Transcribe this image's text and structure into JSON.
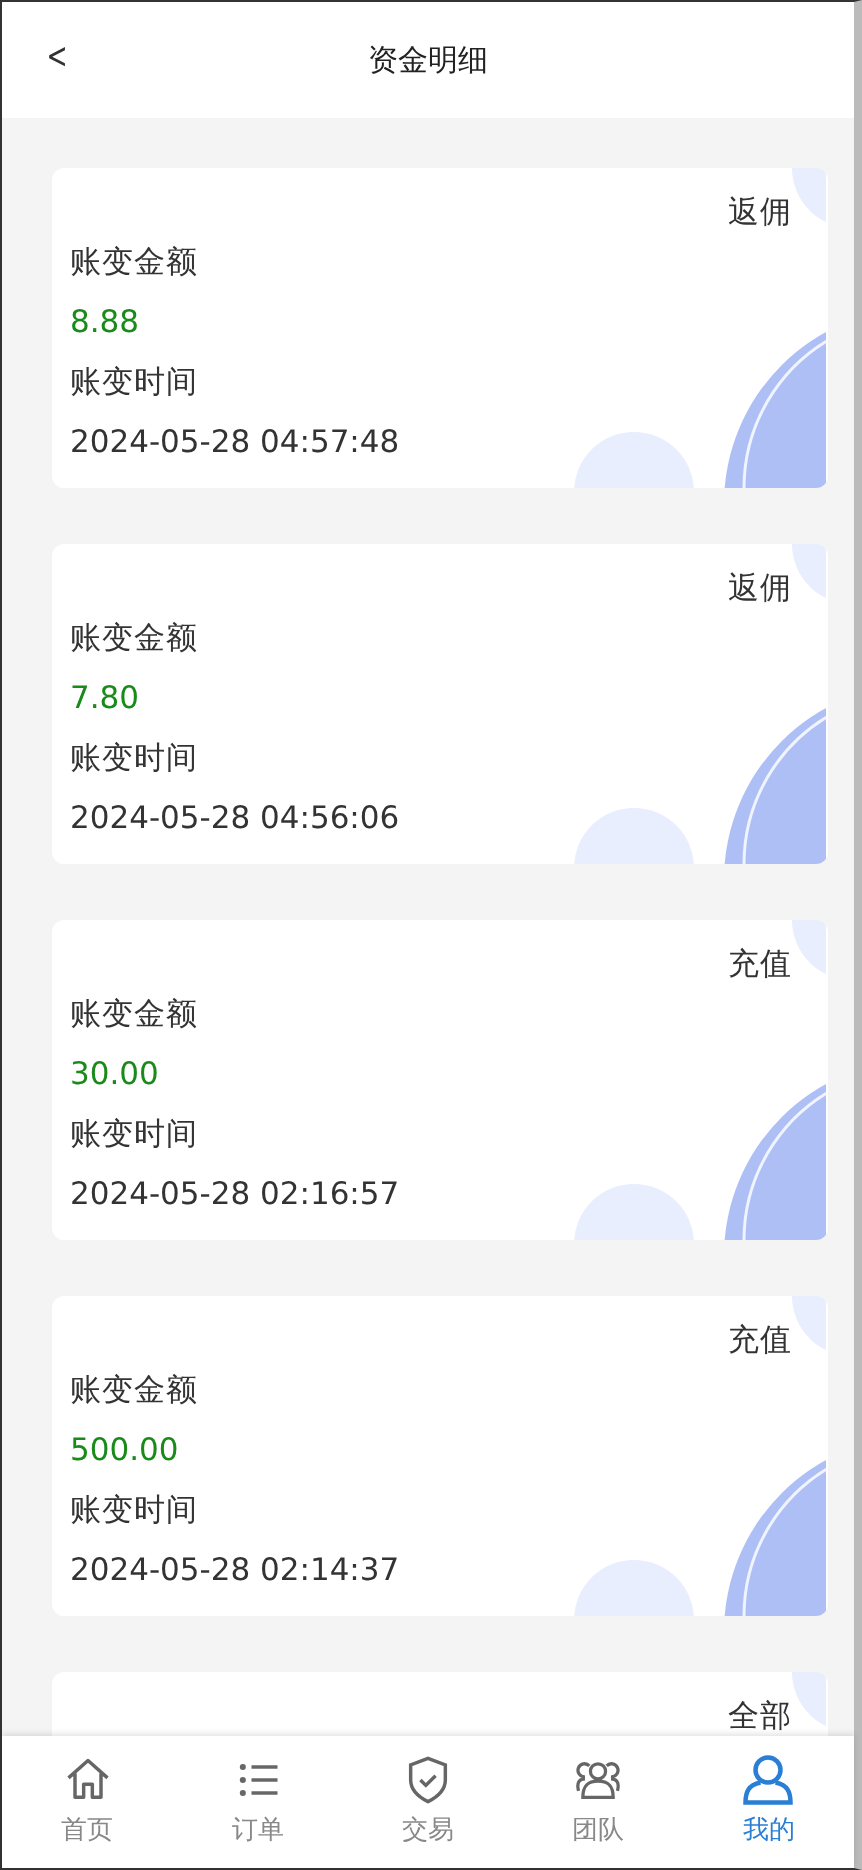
{
  "header": {
    "back": "<",
    "title": "资金明细"
  },
  "records": [
    {
      "type": "返佣",
      "amount_label": "账变金额",
      "amount": "8.88",
      "time_label": "账变时间",
      "time": "2024-05-28 04:57:48"
    },
    {
      "type": "返佣",
      "amount_label": "账变金额",
      "amount": "7.80",
      "time_label": "账变时间",
      "time": "2024-05-28 04:56:06"
    },
    {
      "type": "充值",
      "amount_label": "账变金额",
      "amount": "30.00",
      "time_label": "账变时间",
      "time": "2024-05-28 02:16:57"
    },
    {
      "type": "充值",
      "amount_label": "账变金额",
      "amount": "500.00",
      "time_label": "账变时间",
      "time": "2024-05-28 02:14:37"
    },
    {
      "type": "全部"
    }
  ],
  "tabs": [
    {
      "kind": "home",
      "label": "首页",
      "selected": false
    },
    {
      "kind": "list",
      "label": "订单",
      "selected": false
    },
    {
      "kind": "shield",
      "label": "交易",
      "selected": false
    },
    {
      "kind": "team",
      "label": "团队",
      "selected": false
    },
    {
      "kind": "user",
      "label": "我的",
      "selected": true
    }
  ]
}
